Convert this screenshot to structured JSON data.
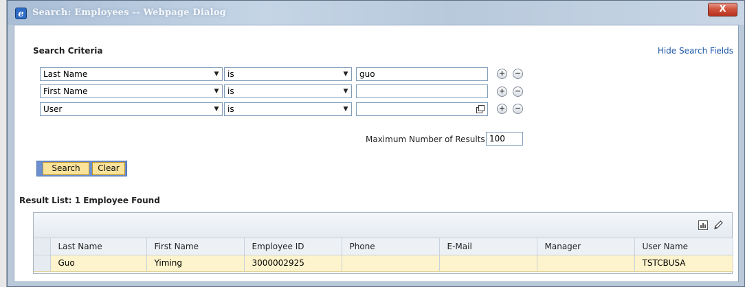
{
  "window": {
    "title": "Search: Employees -- Webpage Dialog",
    "close_label": "X"
  },
  "criteria": {
    "title": "Search Criteria",
    "hide_link": "Hide Search Fields",
    "rows": [
      {
        "field": "Last Name",
        "operator": "is",
        "value": "guo"
      },
      {
        "field": "First Name",
        "operator": "is",
        "value": ""
      },
      {
        "field": "User",
        "operator": "is",
        "value": ""
      }
    ],
    "add_symbol": "+",
    "remove_symbol": "−",
    "max_results_label": "Maximum Number of Results:",
    "max_results_value": "100",
    "search_label": "Search",
    "clear_label": "Clear"
  },
  "results": {
    "title": "Result List: 1 Employee Found",
    "columns": [
      "Last Name",
      "First Name",
      "Employee ID",
      "Phone",
      "E-Mail",
      "Manager",
      "User Name"
    ],
    "rows": [
      [
        "Guo",
        "Yiming",
        "3000002925",
        "",
        "",
        "",
        "TSTCBUSA"
      ]
    ]
  },
  "colors": {
    "accent_link": "#1a55a8",
    "button_bg": "#fbe39a",
    "row_highlight": "#fdf3cc"
  }
}
